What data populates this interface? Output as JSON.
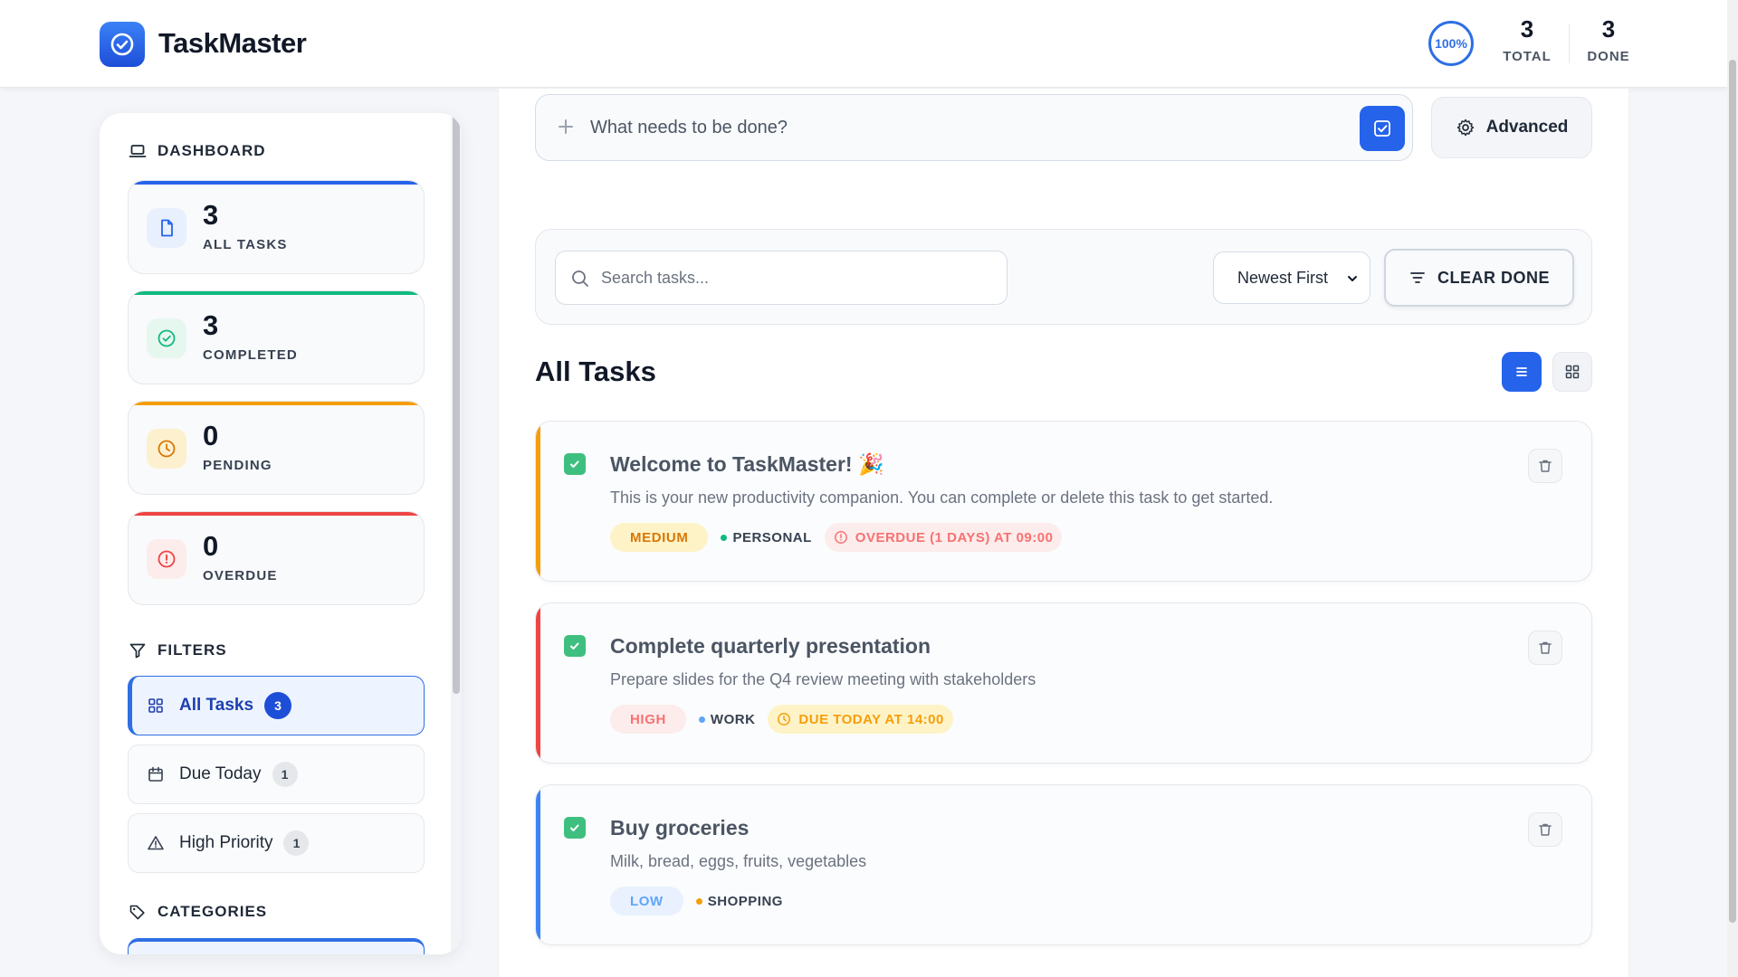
{
  "header": {
    "app_title": "TaskMaster",
    "progress_label": "100%",
    "progress_value": 1.0,
    "stats": [
      {
        "value": "3",
        "label": "TOTAL"
      },
      {
        "value": "3",
        "label": "DONE"
      }
    ]
  },
  "sidebar": {
    "dashboard_title": "DASHBOARD",
    "stat_cards": [
      {
        "value": "3",
        "label": "ALL TASKS",
        "color": "#2563eb",
        "icon": "file-icon"
      },
      {
        "value": "3",
        "label": "COMPLETED",
        "color": "#10b981",
        "icon": "check-circle-icon"
      },
      {
        "value": "0",
        "label": "PENDING",
        "color": "#f59e0b",
        "icon": "clock-icon"
      },
      {
        "value": "0",
        "label": "OVERDUE",
        "color": "#ef4444",
        "icon": "alert-circle-icon"
      }
    ],
    "filters_title": "FILTERS",
    "filters": [
      {
        "label": "All Tasks",
        "count": "3",
        "icon": "grid-icon",
        "active": true
      },
      {
        "label": "Due Today",
        "count": "1",
        "icon": "calendar-icon",
        "active": false
      },
      {
        "label": "High Priority",
        "count": "1",
        "icon": "warning-triangle-icon",
        "active": false
      }
    ],
    "categories_title": "CATEGORIES"
  },
  "composer": {
    "placeholder": "What needs to be done?",
    "advanced_label": "Advanced"
  },
  "toolbar": {
    "search_placeholder": "Search tasks...",
    "sort_selected": "Newest First",
    "clear_label": "CLEAR DONE"
  },
  "list": {
    "title": "All Tasks",
    "view_mode": "list"
  },
  "tasks": [
    {
      "title": "Welcome to TaskMaster! 🎉",
      "description": "This is your new productivity companion. You can complete or delete this task to get started.",
      "priority": "MEDIUM",
      "category": "PERSONAL",
      "due": "OVERDUE (1 DAYS) AT 09:00",
      "completed": true,
      "accent_color": "#f59e0b"
    },
    {
      "title": "Complete quarterly presentation",
      "description": "Prepare slides for the Q4 review meeting with stakeholders",
      "priority": "HIGH",
      "category": "WORK",
      "due": "DUE TODAY AT 14:00",
      "completed": true,
      "accent_color": "#ef4444"
    },
    {
      "title": "Buy groceries",
      "description": "Milk, bread, eggs, fruits, vegetables",
      "priority": "LOW",
      "category": "SHOPPING",
      "due": "",
      "completed": true,
      "accent_color": "#3b82f6"
    }
  ]
}
